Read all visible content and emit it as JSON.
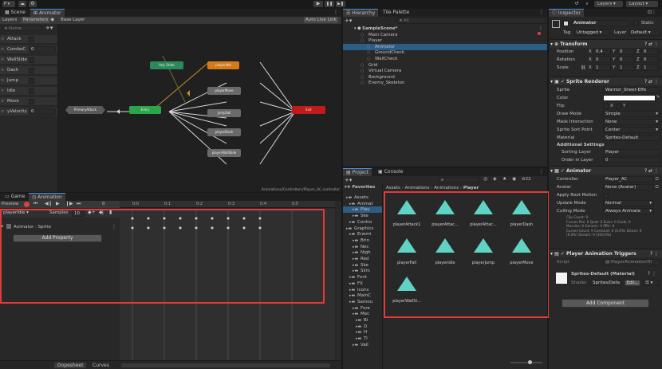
{
  "toolbar": {
    "account": "P",
    "layers": "Layers",
    "layout": "Layout"
  },
  "tabs": {
    "scene": "Scene",
    "animator": "Animator",
    "hierarchy": "Hierarchy",
    "tile_palette": "Tile Palette",
    "inspector": "Inspector",
    "project": "Project",
    "console": "Console",
    "game": "Game",
    "animation": "Animation"
  },
  "animator": {
    "layers_tab": "Layers",
    "parameters_tab": "Parameters",
    "base_layer": "Base Layer",
    "auto_live_link": "Auto Live Link",
    "search_placeholder": "Name",
    "params": [
      {
        "name": "Attack",
        "type": "bool",
        "value": ""
      },
      {
        "name": "ComboC",
        "type": "int",
        "value": "0"
      },
      {
        "name": "WallSlide",
        "type": "bool",
        "value": ""
      },
      {
        "name": "Dash",
        "type": "bool",
        "value": ""
      },
      {
        "name": "Jump",
        "type": "bool",
        "value": ""
      },
      {
        "name": "Idle",
        "type": "bool",
        "value": ""
      },
      {
        "name": "Move",
        "type": "bool",
        "value": ""
      },
      {
        "name": "yVelocity",
        "type": "float",
        "value": "0"
      }
    ],
    "nodes": {
      "any_state": "Any State",
      "entry": "Entry",
      "exit": "Exit",
      "primary": "PrimaryAttack",
      "orange": "playerIdle",
      "s1": "playerMove",
      "s2": "JumpFall",
      "s3": "playerDash",
      "s4": "playerWallSlide"
    },
    "path": "Animations/Controllers/Player_AC.controller"
  },
  "hierarchy": {
    "search_placeholder": "All",
    "items": [
      {
        "label": "SampleScene*",
        "indent": 0,
        "bold": true
      },
      {
        "label": "Main Camera",
        "indent": 1
      },
      {
        "label": "Player",
        "indent": 1
      },
      {
        "label": "Animator",
        "indent": 2,
        "selected": true
      },
      {
        "label": "GroundCheck",
        "indent": 2
      },
      {
        "label": "WallCheck",
        "indent": 2
      },
      {
        "label": "Grid",
        "indent": 1
      },
      {
        "label": "Virtual Camera",
        "indent": 1
      },
      {
        "label": "Background",
        "indent": 1
      },
      {
        "label": "Enemy_Skeleton",
        "indent": 1
      }
    ]
  },
  "project": {
    "breadcrumb": [
      "Assets",
      "Animations",
      "Animations",
      "Player"
    ],
    "count": "22",
    "favorites": "Favorites",
    "tree": [
      "Assets",
      "Animat",
      "Play",
      "Ske",
      "Contro",
      "Graphics",
      "Enemi",
      "Brin",
      "Nec",
      "Nigh",
      "Red",
      "Ske",
      "Slim",
      "Font",
      "FX",
      "Icons",
      "MainC",
      "Samou",
      "Fore",
      "Mec",
      "Bi",
      "D",
      "H",
      "Ti",
      "Vall"
    ],
    "assets": [
      "playerAttack1",
      "playerAttac...",
      "playerAttac...",
      "playerDash",
      "playerFall",
      "playerIdle",
      "playerJump",
      "playerMove",
      "playerWallSl..."
    ]
  },
  "animation": {
    "preview": "Preview",
    "frame": "0",
    "clip": "playerIdle",
    "samples_label": "Samples",
    "samples": "10",
    "property": "Animator : Sprite",
    "add_property": "Add Property",
    "ruler": [
      "0:0",
      "0:1",
      "0:2",
      "0:3",
      "0:4",
      "0:5"
    ],
    "dopesheet": "Dopesheet",
    "curves": "Curves"
  },
  "inspector": {
    "object_name": "Animator",
    "static": "Static",
    "tag_label": "Tag",
    "tag": "Untagged",
    "layer_label": "Layer",
    "layer": "Default",
    "transform": {
      "title": "Transform",
      "position_label": "Position",
      "pos": [
        "0.4",
        "0",
        "0"
      ],
      "rotation_label": "Rotation",
      "rot": [
        "0",
        "0",
        "0"
      ],
      "scale_label": "Scale",
      "scale": [
        "1",
        "1",
        "1"
      ]
    },
    "sprite_renderer": {
      "title": "Sprite Renderer",
      "sprite_label": "Sprite",
      "sprite": "Warrior_Sheet-Effe",
      "color_label": "Color",
      "flip_label": "Flip",
      "flip_x": "X",
      "flip_y": "Y",
      "draw_mode_label": "Draw Mode",
      "draw_mode": "Simple",
      "mask_label": "Mask Interaction",
      "mask": "None",
      "sort_point_label": "Sprite Sort Point",
      "sort_point": "Center",
      "material_label": "Material",
      "material": "Sprites-Default",
      "additional": "Additional Settings",
      "sorting_layer_label": "Sorting Layer",
      "sorting_layer": "Player",
      "order_label": "Order in Layer",
      "order": "0"
    },
    "animator": {
      "title": "Animator",
      "controller_label": "Controller",
      "controller": "Player_AC",
      "avatar_label": "Avatar",
      "avatar": "None (Avatar)",
      "root_motion_label": "Apply Root Motion",
      "update_label": "Update Mode",
      "update": "Normal",
      "culling_label": "Culling Mode",
      "culling": "Always Animate",
      "info": [
        "Clip Count: 9",
        "Curves Pos: 0 Quat: 0 Euler: 0 Scale: 0",
        "Muscles: 0 Generic: 0 PPtr: 9",
        "Curves Count: 9 Constant: 0 (0.0%) Dense: 0",
        "(0.0%) Stream: 9 (100.0%)"
      ]
    },
    "triggers": {
      "title": "Player Animation Triggers",
      "script_label": "Script",
      "script": "PlayerAnimationTri"
    },
    "material": {
      "name": "Sprites-Default (Material)",
      "shader_label": "Shader",
      "shader": "Sprites/Defa",
      "edit": "Edit..."
    },
    "add_component": "Add Component"
  }
}
